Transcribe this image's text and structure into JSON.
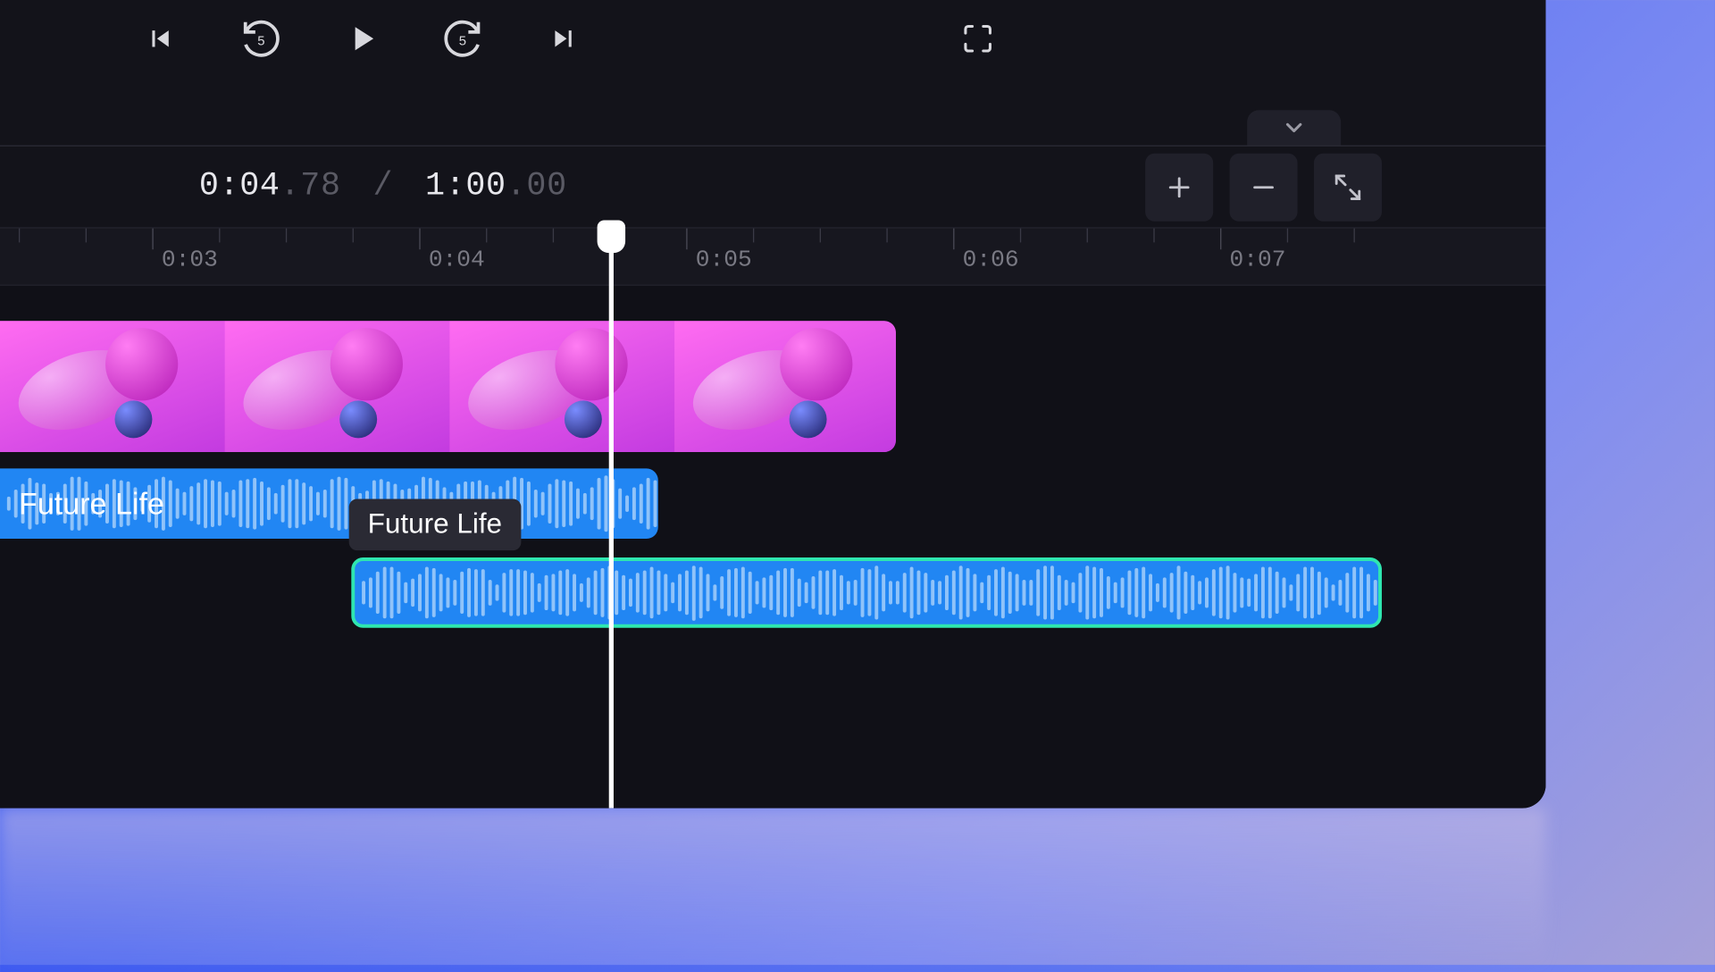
{
  "timecode": {
    "current_main": "0:04",
    "current_frac": ".78",
    "total_main": "1:00",
    "total_frac": ".00"
  },
  "ruler": {
    "labels": [
      "0:03",
      "0:04",
      "0:05",
      "0:06",
      "0:07"
    ]
  },
  "clips": {
    "audio1_label": "Future Life",
    "audio1_tooltip": "Future Life"
  },
  "icons": {
    "skip_prev": "skip-previous",
    "rewind5": "rewind-5s",
    "play": "play",
    "forward5": "forward-5s",
    "skip_next": "skip-next",
    "fullscreen": "fullscreen",
    "expand": "chevron-down",
    "zoom_in": "plus",
    "zoom_out": "minus",
    "fit": "fit-to-screen"
  }
}
